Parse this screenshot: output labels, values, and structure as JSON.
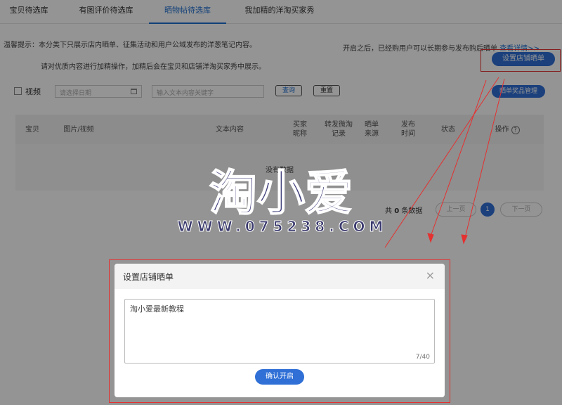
{
  "tabs": [
    {
      "label": "宝贝待选库",
      "active": false
    },
    {
      "label": "有图评价待选库",
      "active": false
    },
    {
      "label": "晒物帖待选库",
      "active": true
    },
    {
      "label": "我加精的洋淘买家秀",
      "active": false
    }
  ],
  "tips": {
    "line1": "温馨提示：本分类下只展示店内晒单、征集活动和用户公域发布的洋葱笔记内容。",
    "line2": "请对优质内容进行加精操作，加精后会在宝贝和店铺洋淘买家秀中展示。",
    "right": "开启之后，已经购用户可以长期参与发布购后晒单",
    "right_link": "查看详情>>"
  },
  "buttons": {
    "setup_store_show": "设置店铺晒单",
    "prize_manage": "晒单奖品管理",
    "query": "查询",
    "reset": "重置"
  },
  "filters": {
    "video_label": "视频",
    "date_placeholder": "请选择日期",
    "keyword_placeholder": "输入文本内容关键字"
  },
  "table": {
    "headers": [
      "宝贝",
      "图片/视频",
      "文本内容",
      "买家昵称",
      "转发微淘记录",
      "晒单来源",
      "发布时间",
      "状态",
      "操作"
    ],
    "empty_text": "没有数据"
  },
  "pager": {
    "total_prefix": "共",
    "total_count": "0",
    "total_suffix": "条数据",
    "prev": "上一页",
    "current": "1",
    "next": "下一页"
  },
  "watermark": {
    "logo": "淘小爱",
    "url": "WWW.075238.COM"
  },
  "dialog": {
    "title": "设置店铺晒单",
    "close_glyph": "×",
    "textarea_value": "淘小爱最新教程",
    "count": "7/40",
    "confirm": "确认开启"
  },
  "colors": {
    "accent": "#2f6fd6",
    "highlight": "#e53030"
  },
  "icons": [
    "calendar-icon",
    "help-circle-icon",
    "close-icon",
    "checkbox-icon"
  ]
}
